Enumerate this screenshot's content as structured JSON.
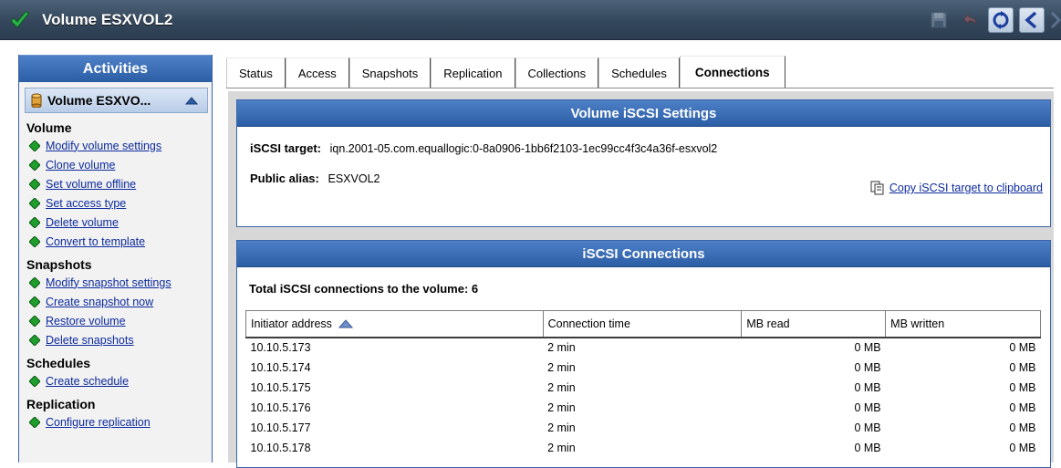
{
  "window": {
    "title": "Volume ESXVOL2",
    "toolbar_icons": [
      "save-icon",
      "undo-icon",
      "refresh-icon",
      "back-icon",
      "forward-icon"
    ]
  },
  "colors": {
    "accent_blue": "#2c5ea6",
    "link": "#0c2a9e",
    "action_diamond": "#1f9e2c",
    "titlebar": "#34475c"
  },
  "sidebar": {
    "header": "Activities",
    "volume_label": "Volume ESXVO...",
    "sections": [
      {
        "title": "Volume",
        "items": [
          {
            "label": "Modify volume settings"
          },
          {
            "label": "Clone volume"
          },
          {
            "label": "Set volume offline"
          },
          {
            "label": "Set access type"
          },
          {
            "label": "Delete volume"
          },
          {
            "label": "Convert to template"
          }
        ]
      },
      {
        "title": "Snapshots",
        "items": [
          {
            "label": "Modify snapshot settings"
          },
          {
            "label": "Create snapshot now"
          },
          {
            "label": "Restore volume"
          },
          {
            "label": "Delete snapshots"
          }
        ]
      },
      {
        "title": "Schedules",
        "items": [
          {
            "label": "Create schedule"
          }
        ]
      },
      {
        "title": "Replication",
        "items": [
          {
            "label": "Configure replication"
          }
        ]
      }
    ]
  },
  "tabs": [
    {
      "label": "Status"
    },
    {
      "label": "Access"
    },
    {
      "label": "Snapshots"
    },
    {
      "label": "Replication"
    },
    {
      "label": "Collections"
    },
    {
      "label": "Schedules"
    },
    {
      "label": "Connections",
      "active": true
    }
  ],
  "iscsi_settings": {
    "header": "Volume iSCSI Settings",
    "target_label": "iSCSI target:",
    "target_value": "iqn.2001-05.com.equallogic:0-8a0906-1bb6f2103-1ec99cc4f3c4a36f-esxvol2",
    "alias_label": "Public alias:",
    "alias_value": "ESXVOL2",
    "copy_link": "Copy iSCSI target to clipboard"
  },
  "iscsi_connections": {
    "header": "iSCSI Connections",
    "total_text": "Total iSCSI connections to the volume: 6",
    "columns": [
      "Initiator address",
      "Connection time",
      "MB read",
      "MB written"
    ],
    "sort_column": "Initiator address",
    "rows": [
      {
        "initiator": "10.10.5.173",
        "time": "2 min",
        "read": "0 MB",
        "written": "0 MB"
      },
      {
        "initiator": "10.10.5.174",
        "time": "2 min",
        "read": "0 MB",
        "written": "0 MB"
      },
      {
        "initiator": "10.10.5.175",
        "time": "2 min",
        "read": "0 MB",
        "written": "0 MB"
      },
      {
        "initiator": "10.10.5.176",
        "time": "2 min",
        "read": "0 MB",
        "written": "0 MB"
      },
      {
        "initiator": "10.10.5.177",
        "time": "2 min",
        "read": "0 MB",
        "written": "0 MB"
      },
      {
        "initiator": "10.10.5.178",
        "time": "2 min",
        "read": "0 MB",
        "written": "0 MB"
      }
    ]
  }
}
